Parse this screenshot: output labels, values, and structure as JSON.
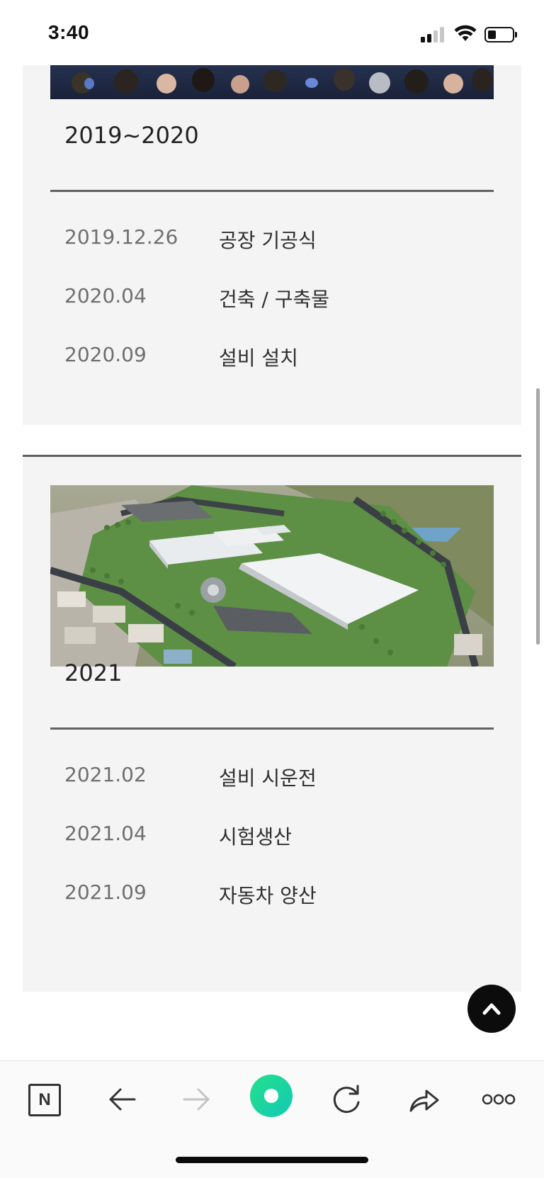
{
  "status_bar": {
    "time": "3:40"
  },
  "timeline": [
    {
      "year": "2019~2020",
      "events": [
        {
          "date": "2019.12.26",
          "desc": "공장 기공식"
        },
        {
          "date": "2020.04",
          "desc": "건축 / 구축물"
        },
        {
          "date": "2020.09",
          "desc": "설비 설치"
        }
      ]
    },
    {
      "year": "2021",
      "events": [
        {
          "date": "2021.02",
          "desc": "설비 시운전"
        },
        {
          "date": "2021.04",
          "desc": "시험생산"
        },
        {
          "date": "2021.09",
          "desc": "자동차 양산"
        }
      ]
    }
  ],
  "toolbar": {
    "naver_label": "N",
    "icons": [
      "naver-icon",
      "back-arrow-icon",
      "forward-arrow-icon",
      "home-circle-icon",
      "reload-icon",
      "share-icon",
      "more-icon"
    ]
  },
  "colors": {
    "panel_bg": "#f4f4f4",
    "rule": "#5f6165",
    "home_accent": "#1ad6a0"
  }
}
